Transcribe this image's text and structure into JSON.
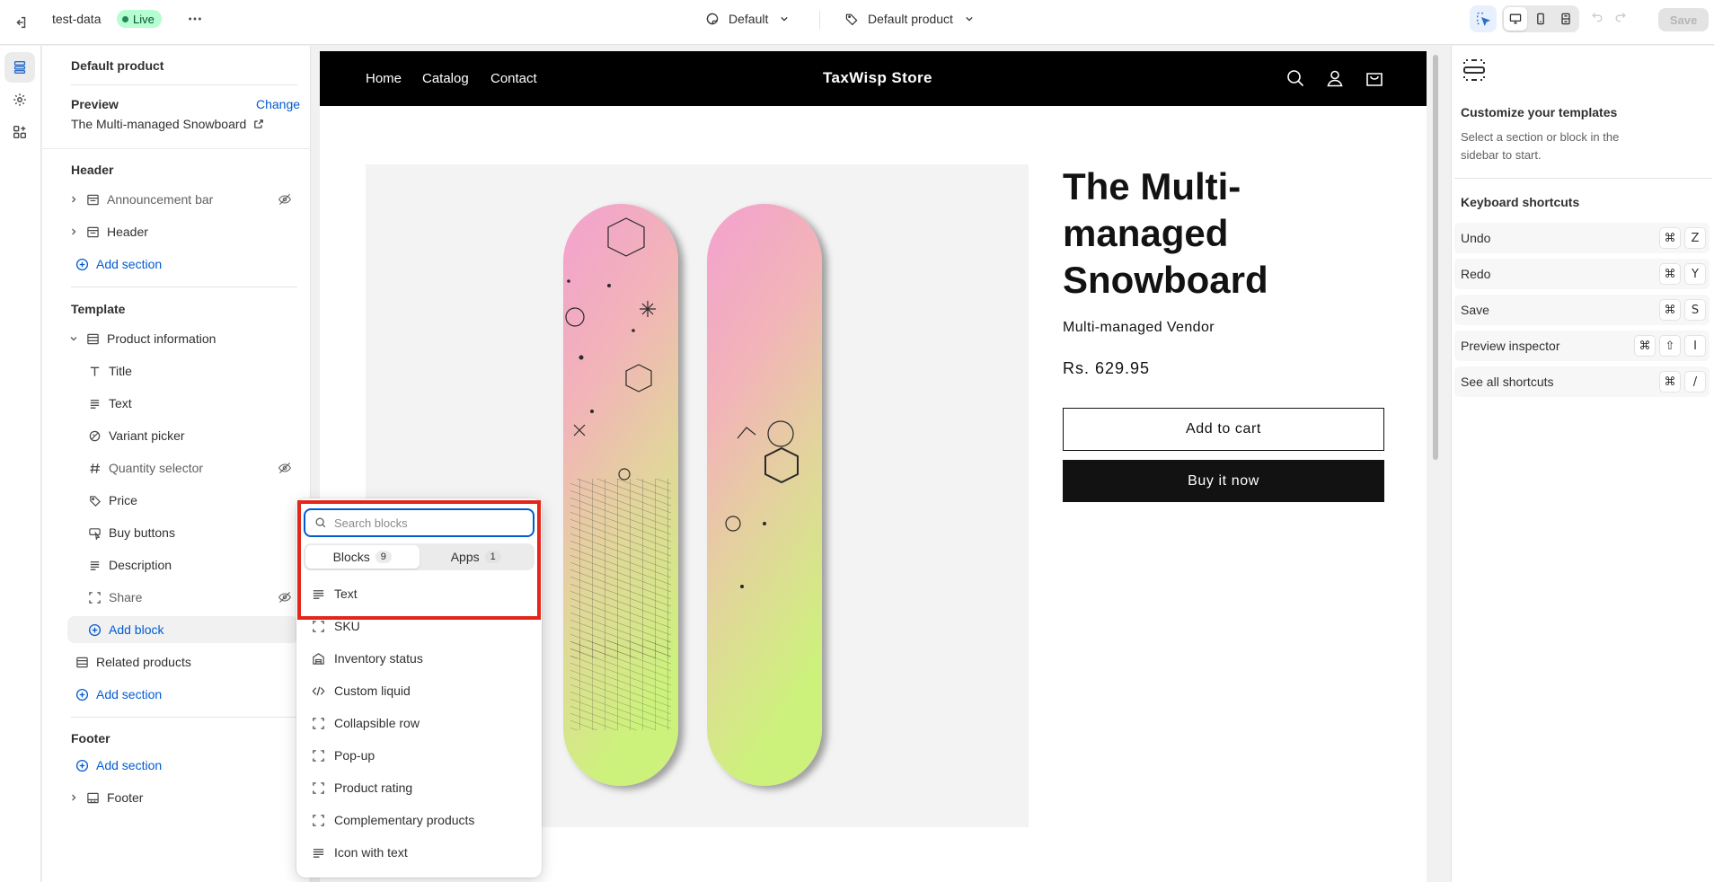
{
  "topbar": {
    "store_name": "test-data",
    "live_badge": "Live",
    "theme_label": "Default",
    "template_label": "Default product",
    "save_label": "Save"
  },
  "sidebar": {
    "title": "Default product",
    "preview_label": "Preview",
    "change_link": "Change",
    "preview_product": "The Multi-managed Snowboard",
    "header_group": "Header",
    "header_items": [
      "Announcement bar",
      "Header"
    ],
    "add_section": "Add section",
    "template_group": "Template",
    "product_info": "Product information",
    "blocks": [
      "Title",
      "Text",
      "Variant picker",
      "Quantity selector",
      "Price",
      "Buy buttons",
      "Description",
      "Share"
    ],
    "add_block": "Add block",
    "related_products": "Related products",
    "footer_group": "Footer",
    "footer_item": "Footer"
  },
  "store": {
    "nav": [
      "Home",
      "Catalog",
      "Contact"
    ],
    "name": "TaxWisp Store",
    "product_title": "The Multi-managed Snowboard",
    "vendor": "Multi-managed Vendor",
    "price": "Rs. 629.95",
    "add_to_cart": "Add to cart",
    "buy_now": "Buy it now"
  },
  "block_picker": {
    "search_placeholder": "Search blocks",
    "tabs": [
      {
        "label": "Blocks",
        "count": "9"
      },
      {
        "label": "Apps",
        "count": "1"
      }
    ],
    "items": [
      "Text",
      "SKU",
      "Inventory status",
      "Custom liquid",
      "Collapsible row",
      "Pop-up",
      "Product rating",
      "Complementary products",
      "Icon with text"
    ]
  },
  "right_panel": {
    "title": "Customize your templates",
    "description": "Select a section or block in the sidebar to start.",
    "shortcuts_title": "Keyboard shortcuts",
    "shortcuts": [
      {
        "label": "Undo",
        "keys": [
          "⌘",
          "Z"
        ]
      },
      {
        "label": "Redo",
        "keys": [
          "⌘",
          "Y"
        ]
      },
      {
        "label": "Save",
        "keys": [
          "⌘",
          "S"
        ]
      },
      {
        "label": "Preview inspector",
        "keys": [
          "⌘",
          "⇧",
          "I"
        ]
      },
      {
        "label": "See all shortcuts",
        "keys": [
          "⌘",
          "/"
        ]
      }
    ]
  },
  "colors": {
    "accent": "#005bd3",
    "live_badge_bg": "#b4fed2",
    "highlight": "#e3261b",
    "store_header": "#000000"
  }
}
